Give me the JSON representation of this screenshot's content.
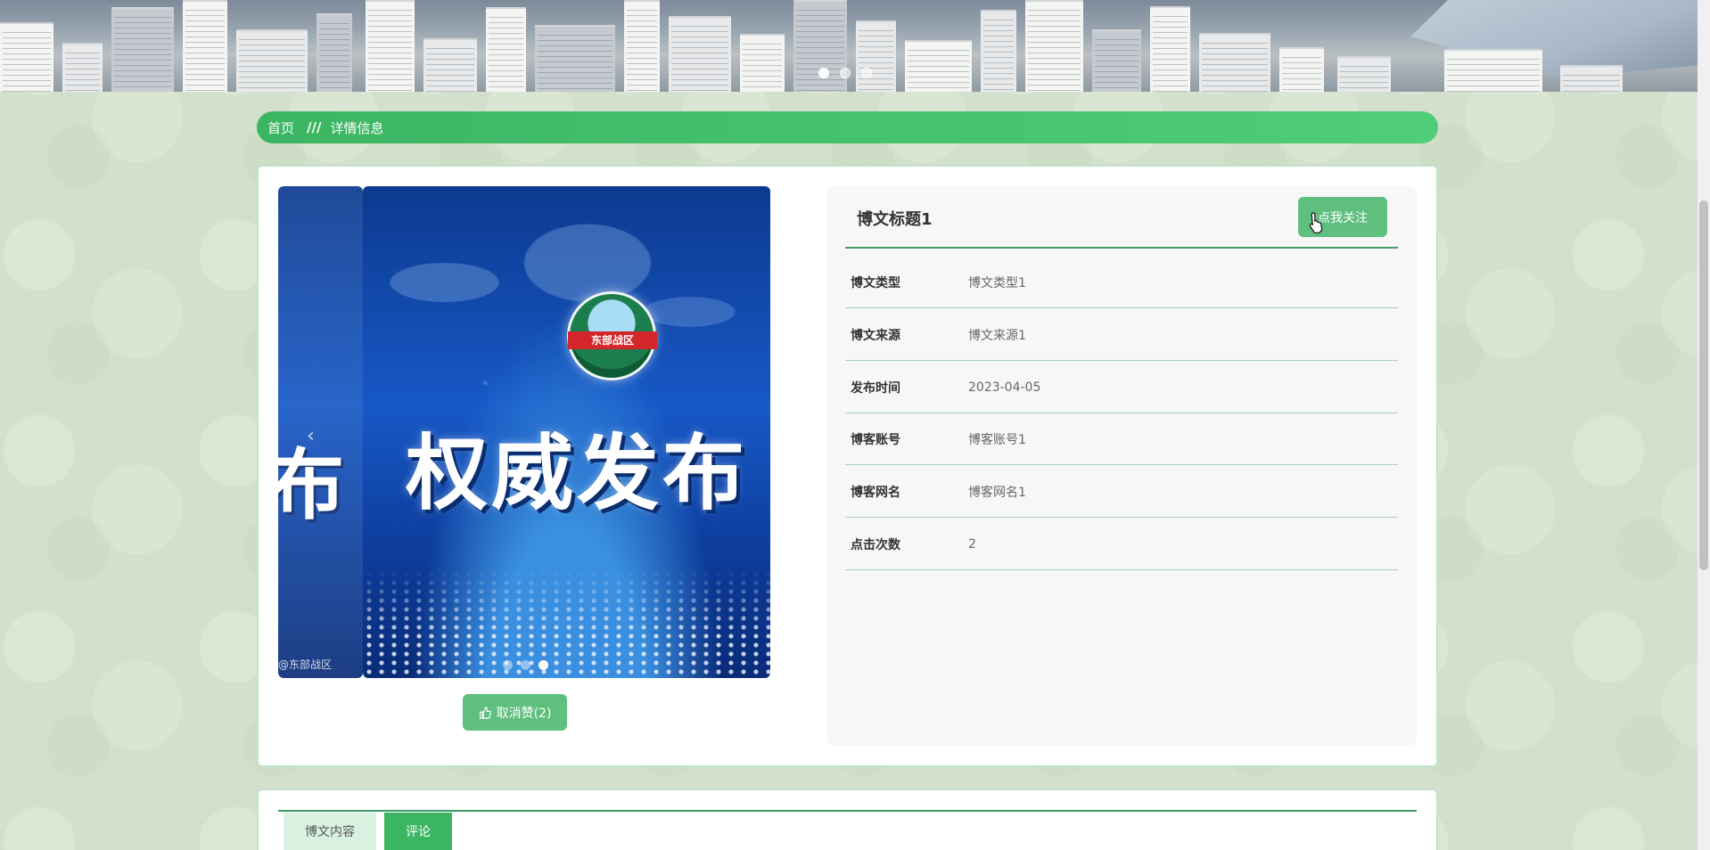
{
  "banner": {
    "dots": 3,
    "active_dot": 0
  },
  "breadcrumb": {
    "home": "首页",
    "separator": "///",
    "current": "详情信息"
  },
  "carousel": {
    "side_text": "布",
    "headline": "权威发布",
    "emblem_text": "东部战区",
    "watermark": "@东部战区",
    "dots": 3,
    "active_dot": 2
  },
  "like_button": {
    "label": "取消赞(2)",
    "icon": "thumbs-up-icon"
  },
  "detail": {
    "title": "博文标题1",
    "follow_label": "点我关注",
    "rows": [
      {
        "label": "博文类型",
        "value": "博文类型1"
      },
      {
        "label": "博文来源",
        "value": "博文来源1"
      },
      {
        "label": "发布时间",
        "value": "2023-04-05"
      },
      {
        "label": "博客账号",
        "value": "博客账号1"
      },
      {
        "label": "博客网名",
        "value": "博客网名1"
      },
      {
        "label": "点击次数",
        "value": "2"
      }
    ]
  },
  "tabs": [
    {
      "label": "博文内容",
      "active": false
    },
    {
      "label": "评论",
      "active": true
    }
  ],
  "colors": {
    "accent": "#3cb563",
    "button": "#5fbf7f",
    "page_bg": "#d3e0cc"
  }
}
